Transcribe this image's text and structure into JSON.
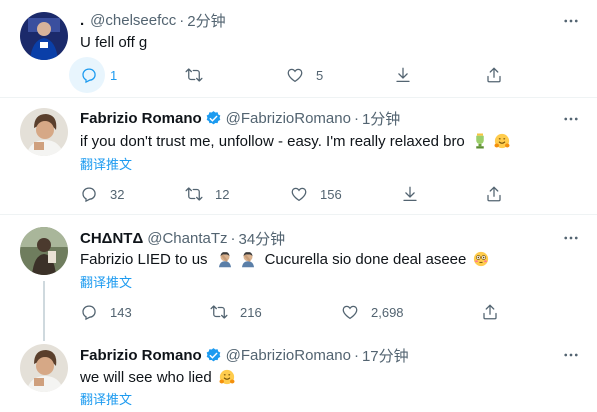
{
  "tweets": [
    {
      "handle": "@chelseefcc",
      "time": "2分钟",
      "text": "U fell off g",
      "counts": {
        "reply": "1",
        "retweet": "",
        "like": "5"
      }
    },
    {
      "name": "Fabrizio Romano",
      "handle": "@FabrizioRomano",
      "time": "1分钟",
      "text": "if you don't trust me, unfollow - easy. I'm really relaxed bro",
      "translate": "翻译推文",
      "counts": {
        "reply": "32",
        "retweet": "12",
        "like": "156"
      }
    },
    {
      "name": "CHΔNTΔ",
      "handle": "@ChantaTz",
      "time": "34分钟",
      "text_a": "Fabrizio LIED to us",
      "text_b": "Cucurella sio done deal aseee",
      "translate": "翻译推文",
      "counts": {
        "reply": "143",
        "retweet": "216",
        "like": "2,698"
      }
    },
    {
      "name": "Fabrizio Romano",
      "handle": "@FabrizioRomano",
      "time": "17分钟",
      "text": "we will see who lied",
      "translate": "翻译推文"
    }
  ],
  "ui": {
    "dot": ".",
    "sep": "·"
  },
  "colors": {
    "accent": "#1d9bf0",
    "muted": "#536471",
    "text": "#0f1419",
    "separator": "#eff3f4"
  },
  "icons": [
    "reply-icon",
    "retweet-icon",
    "like-icon",
    "download-icon",
    "share-icon",
    "more-icon",
    "verified-icon"
  ]
}
